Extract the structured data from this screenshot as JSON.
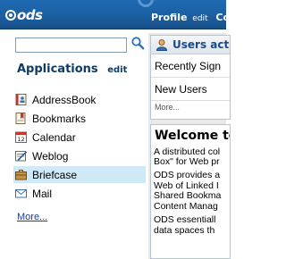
{
  "topbar": {
    "logo_text": "ods",
    "profile_label": "Profile",
    "profile_edit": "edit",
    "community_label": "Comm"
  },
  "search": {
    "value": "",
    "placeholder": ""
  },
  "applications": {
    "heading": "Applications",
    "edit_label": "edit",
    "items": [
      {
        "label": "AddressBook",
        "icon": "addressbook-icon",
        "selected": false
      },
      {
        "label": "Bookmarks",
        "icon": "bookmarks-icon",
        "selected": false
      },
      {
        "label": "Calendar",
        "icon": "calendar-icon",
        "selected": false
      },
      {
        "label": "Weblog",
        "icon": "weblog-icon",
        "selected": false
      },
      {
        "label": "Briefcase",
        "icon": "briefcase-icon",
        "selected": true
      },
      {
        "label": "Mail",
        "icon": "mail-icon",
        "selected": false
      }
    ],
    "more_label": "More..."
  },
  "users_panel": {
    "title": "Users act",
    "rows": [
      "Recently Sign",
      "New Users"
    ],
    "more_label": "More..."
  },
  "welcome_panel": {
    "title": "Welcome to",
    "intro_lines": [
      "A distributed col",
      "Box\" for Web pr"
    ],
    "para1_lines": [
      "ODS provides a",
      "Web of Linked I",
      "Shared Bookma",
      "Content Manag"
    ],
    "para2_lines": [
      "ODS essentiall",
      "data spaces th"
    ]
  },
  "colors": {
    "topbar": "#1b5e9f",
    "heading_text": "#0f3b66",
    "link": "#1a3fa3",
    "selected_row": "#cfe9f7",
    "panel_border": "#b7c5d3",
    "column_bg": "#e9e9e9"
  }
}
